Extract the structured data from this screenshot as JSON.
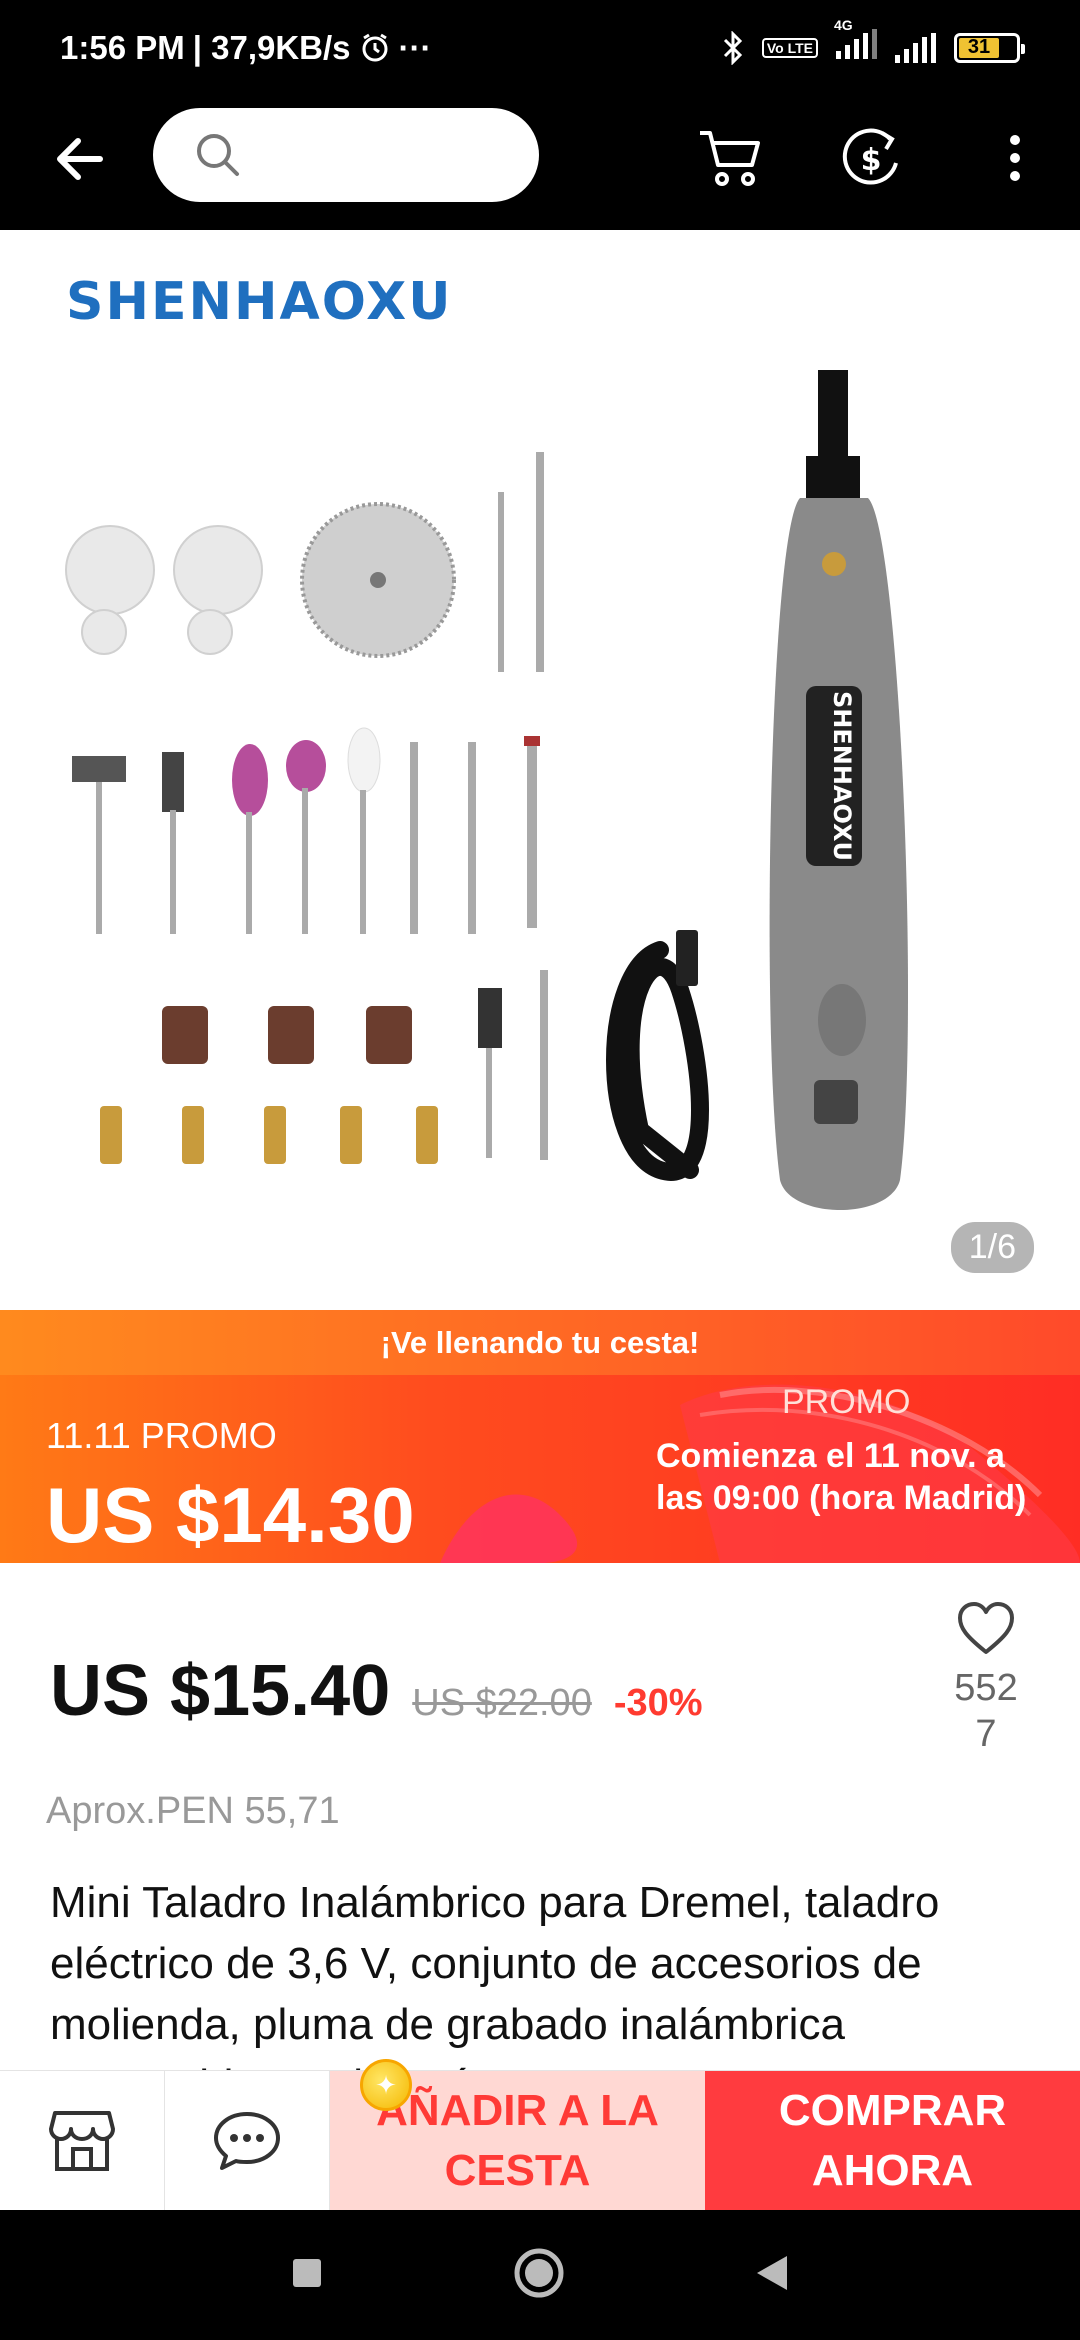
{
  "status_bar": {
    "time": "1:56 PM",
    "speed": "| 37,9KB/s",
    "more": "···",
    "net_label": "4G",
    "volte": "Vo LTE",
    "battery_level": "31"
  },
  "app_bar": {
    "search_placeholder": ""
  },
  "gallery": {
    "brand": "SHENHAOXU",
    "counter": "1/6"
  },
  "promo": {
    "banner": "¡Ve llenando tu cesta!",
    "label": "11.11 PROMO",
    "price": "US $14.30",
    "tag": "PROMO",
    "start": "Comienza el 11 nov. a las 09:00 (hora Madrid)"
  },
  "product": {
    "price": "US $15.40",
    "original_price": "US $22.00",
    "discount": "-30%",
    "wishlist_count": "5527",
    "approx": "Aprox.PEN 55,71",
    "title": "Mini Taladro Inalámbrico para Dremel, taladro eléctrico de 3,6 V, conjunto de accesorios de molienda, pluma de grabado inalámbrica recargable con batería"
  },
  "actions": {
    "add_to_cart": "AÑADIR A LA CESTA",
    "buy_now": "COMPRAR AHORA"
  },
  "colors": {
    "accent_red": "#ff3b3f",
    "promo_orange": "#ff7a16",
    "brand_blue": "#1f6fbf"
  }
}
